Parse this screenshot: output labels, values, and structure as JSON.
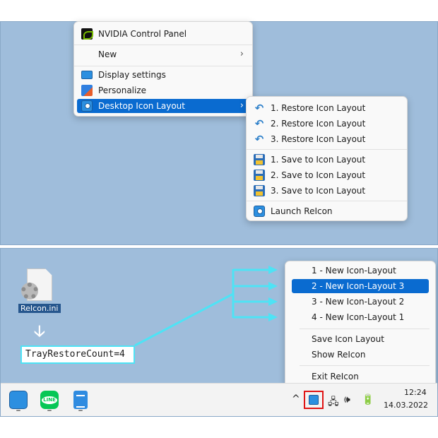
{
  "context_menu": {
    "items": [
      {
        "label": "NVIDIA Control Panel",
        "icon": "nvidia-icon"
      },
      {
        "label": "New",
        "icon": "",
        "submenu": true
      },
      {
        "label": "Display settings",
        "icon": "display-icon"
      },
      {
        "label": "Personalize",
        "icon": "personalize-icon"
      },
      {
        "label": "Desktop Icon Layout",
        "icon": "desktop-icon-layout-icon",
        "submenu": true,
        "selected": true
      }
    ],
    "arrow_glyph": "›"
  },
  "submenu": {
    "restore": [
      "1. Restore Icon Layout",
      "2. Restore Icon Layout",
      "3. Restore Icon Layout"
    ],
    "save": [
      "1. Save to Icon Layout",
      "2. Save to Icon Layout",
      "3. Save to Icon Layout"
    ],
    "launch": "Launch ReIcon"
  },
  "desktop": {
    "file_label": "ReIcon.ini",
    "down_arrow": "🡣",
    "ini_line": "TrayRestoreCount=4"
  },
  "tray_menu": {
    "layouts": [
      "1 - New Icon-Layout",
      "2 - New Icon-Layout 3",
      "3 - New Icon-Layout 2",
      "4 - New Icon-Layout 1"
    ],
    "selected_index": 1,
    "save": "Save Icon Layout",
    "show": "Show ReIcon",
    "exit": "Exit ReIcon"
  },
  "taskbar": {
    "apps": [
      "reicon-app-icon",
      "line-app-icon",
      "notepad-app-icon"
    ],
    "tray_glyphs": {
      "chevron": "^",
      "network": "🖧",
      "volume": "🕪",
      "battery": "🔋"
    },
    "time": "12:24",
    "date": "14.03.2022"
  },
  "colors": {
    "accent": "#0a6bd0",
    "arrow": "#4ee3f5",
    "highlight_box": "#e01414",
    "desktop": "#9fbddb"
  }
}
